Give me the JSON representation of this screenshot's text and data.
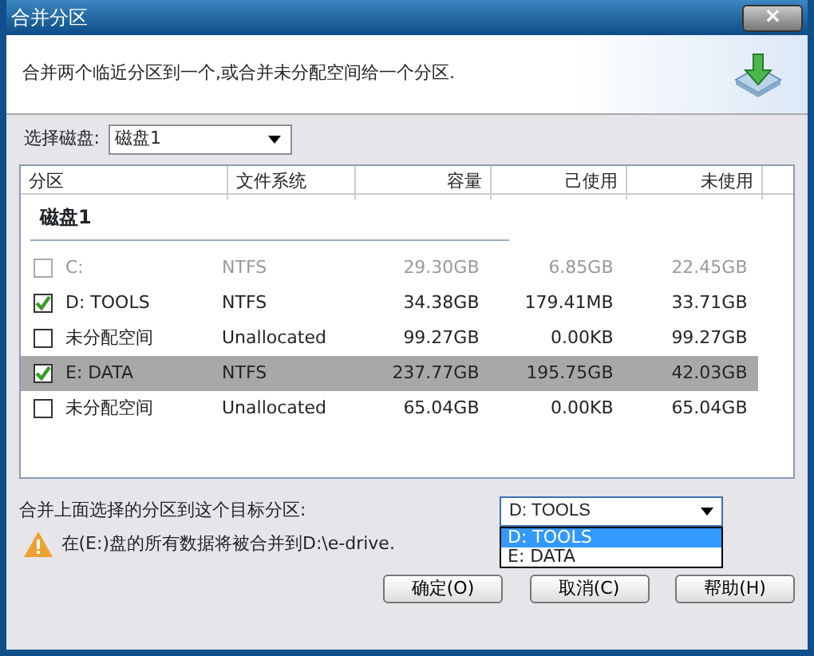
{
  "window": {
    "title": "合并分区",
    "close": "×"
  },
  "header": {
    "description": "合并两个临近分区到一个,或合并未分配空间给一个分区."
  },
  "disk_select": {
    "label": "选择磁盘:",
    "value": "磁盘1"
  },
  "table": {
    "columns": [
      "分区",
      "文件系统",
      "容量",
      "己使用",
      "未使用"
    ],
    "group": "磁盘1",
    "rows": [
      {
        "partition": "C:",
        "file_system": "NTFS",
        "capacity": "29.30GB",
        "used": "6.85GB",
        "free": "22.45GB",
        "checked": false,
        "disabled": true,
        "selected": false
      },
      {
        "partition": "D:  TOOLS",
        "file_system": "NTFS",
        "capacity": "34.38GB",
        "used": "179.41MB",
        "free": "33.71GB",
        "checked": true,
        "disabled": false,
        "selected": false
      },
      {
        "partition": "未分配空间",
        "file_system": "Unallocated",
        "capacity": "99.27GB",
        "used": "0.00KB",
        "free": "99.27GB",
        "checked": false,
        "disabled": false,
        "selected": false
      },
      {
        "partition": "E:  DATA",
        "file_system": "NTFS",
        "capacity": "237.77GB",
        "used": "195.75GB",
        "free": "42.03GB",
        "checked": true,
        "disabled": false,
        "selected": true
      },
      {
        "partition": "未分配空间",
        "file_system": "Unallocated",
        "capacity": "65.04GB",
        "used": "0.00KB",
        "free": "65.04GB",
        "checked": false,
        "disabled": false,
        "selected": false
      }
    ]
  },
  "target": {
    "label": "合并上面选择的分区到这个目标分区:",
    "value": "D:  TOOLS",
    "expanded": true,
    "options": [
      {
        "label": "D:  TOOLS",
        "selected": true
      },
      {
        "label": "E:  DATA",
        "selected": false
      }
    ]
  },
  "warning": "在(E:)盘的所有数据将被合并到D:\\e-drive.",
  "buttons": [
    "确定(O)",
    "取消(C)",
    "帮助(H)"
  ]
}
